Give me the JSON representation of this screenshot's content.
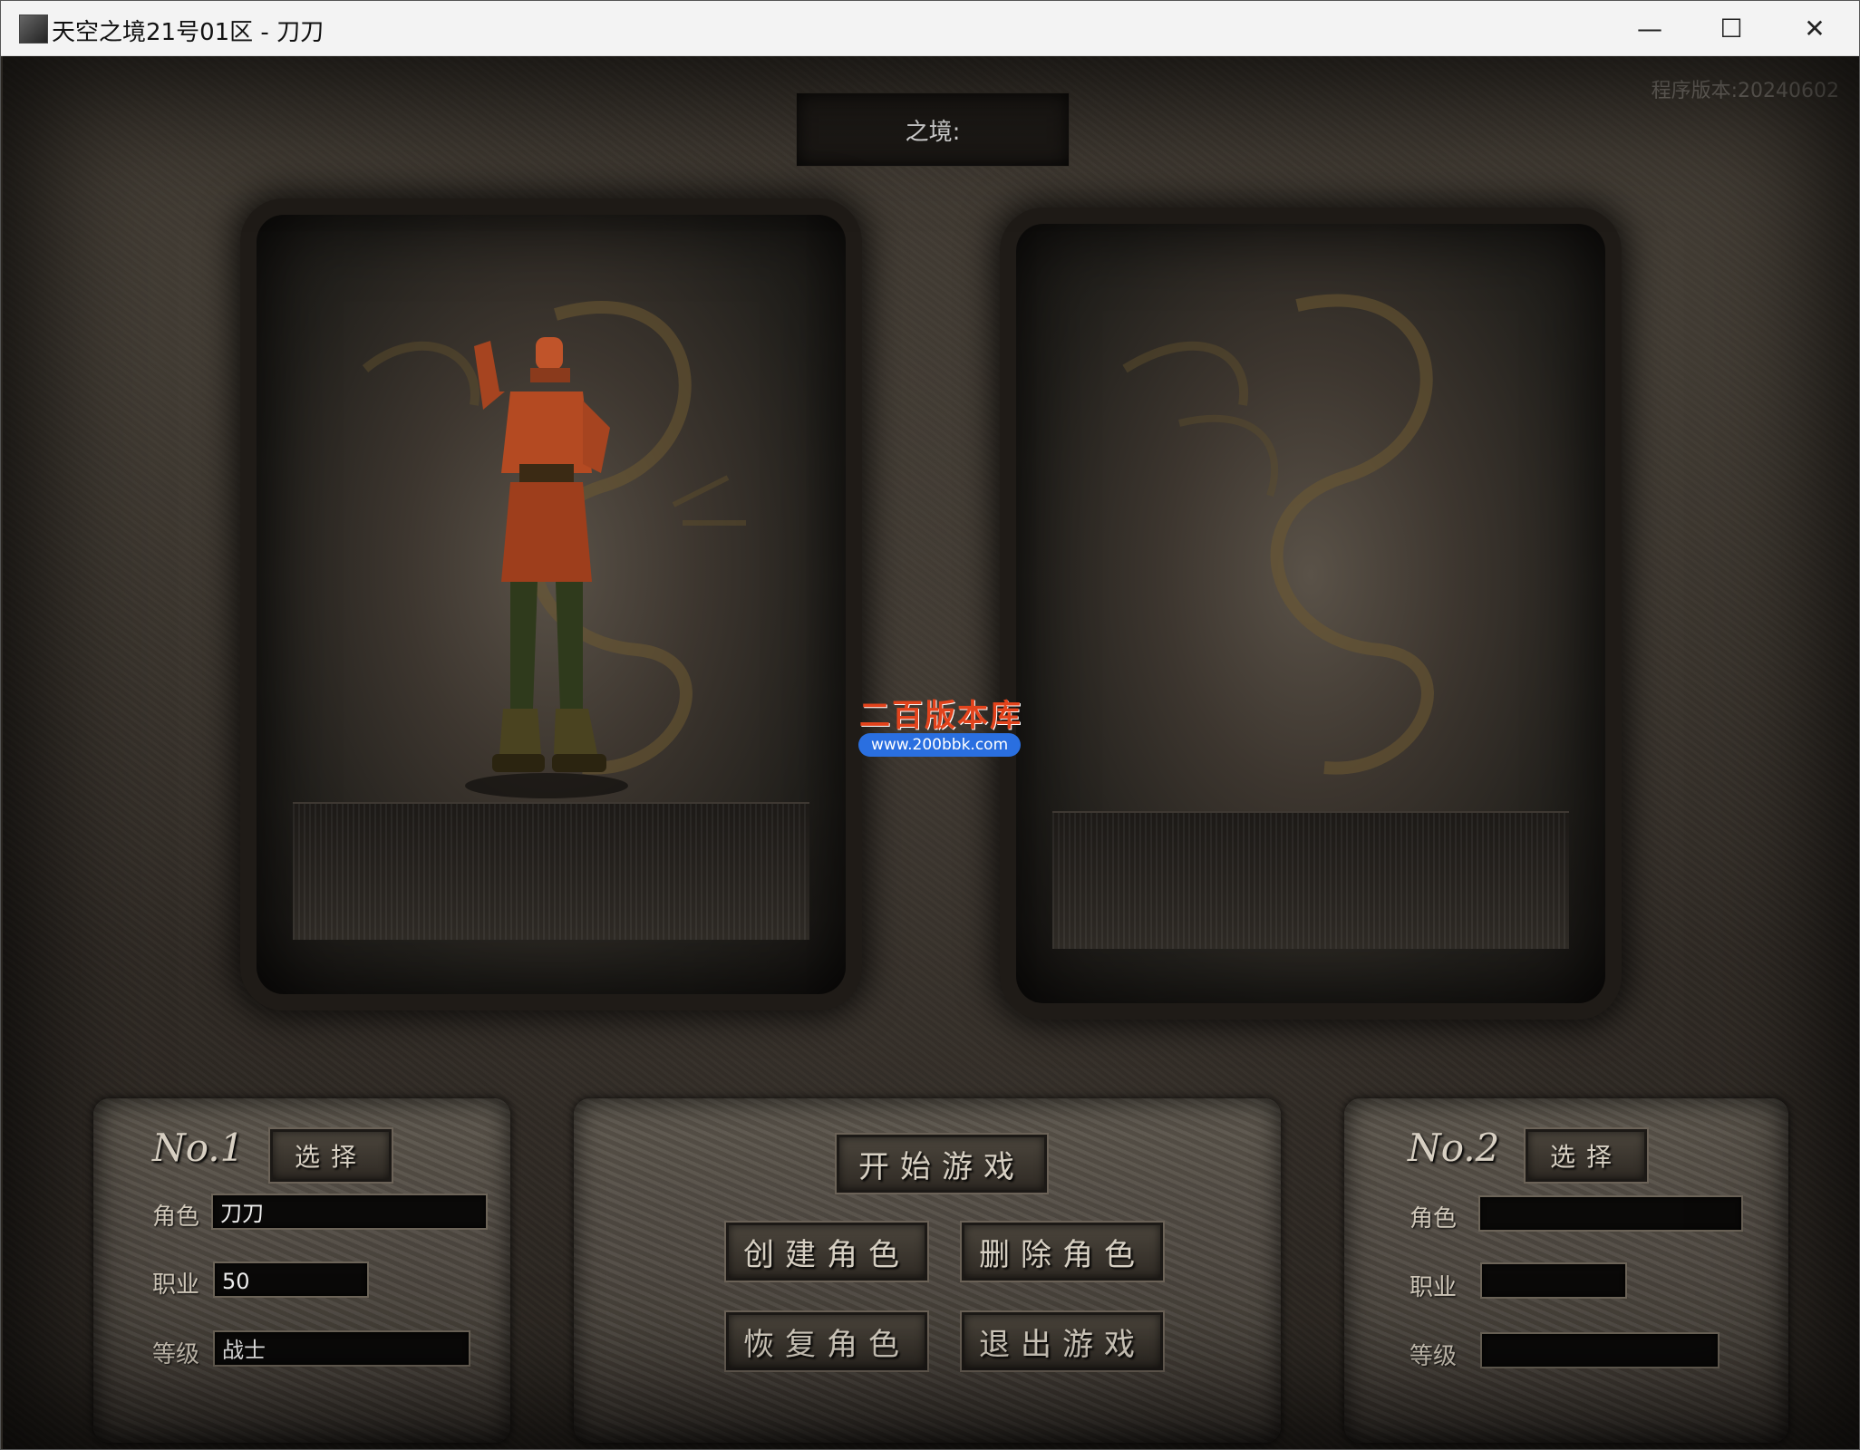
{
  "window": {
    "title": "天空之境21号01区 - 刀刀",
    "minimize_glyph": "—",
    "maximize_glyph": "☐",
    "close_glyph": "✕"
  },
  "version": "程序版本:20240602",
  "server_name": "之境:",
  "watermark": {
    "title": "二百版本库",
    "url": "www.200bbk.com"
  },
  "slot1": {
    "number": "No.1",
    "select_label": "选择",
    "role_label": "角色",
    "role_value": "刀刀",
    "job_label": "职业",
    "job_value": "50",
    "level_label": "等级",
    "level_value": "战士"
  },
  "slot2": {
    "number": "No.2",
    "select_label": "选择",
    "role_label": "角色",
    "role_value": "",
    "job_label": "职业",
    "job_value": "",
    "level_label": "等级",
    "level_value": ""
  },
  "actions": {
    "start_game": "开始游戏",
    "create_role": "创建角色",
    "delete_role": "删除角色",
    "restore_role": "恢复角色",
    "exit_game": "退出游戏"
  }
}
